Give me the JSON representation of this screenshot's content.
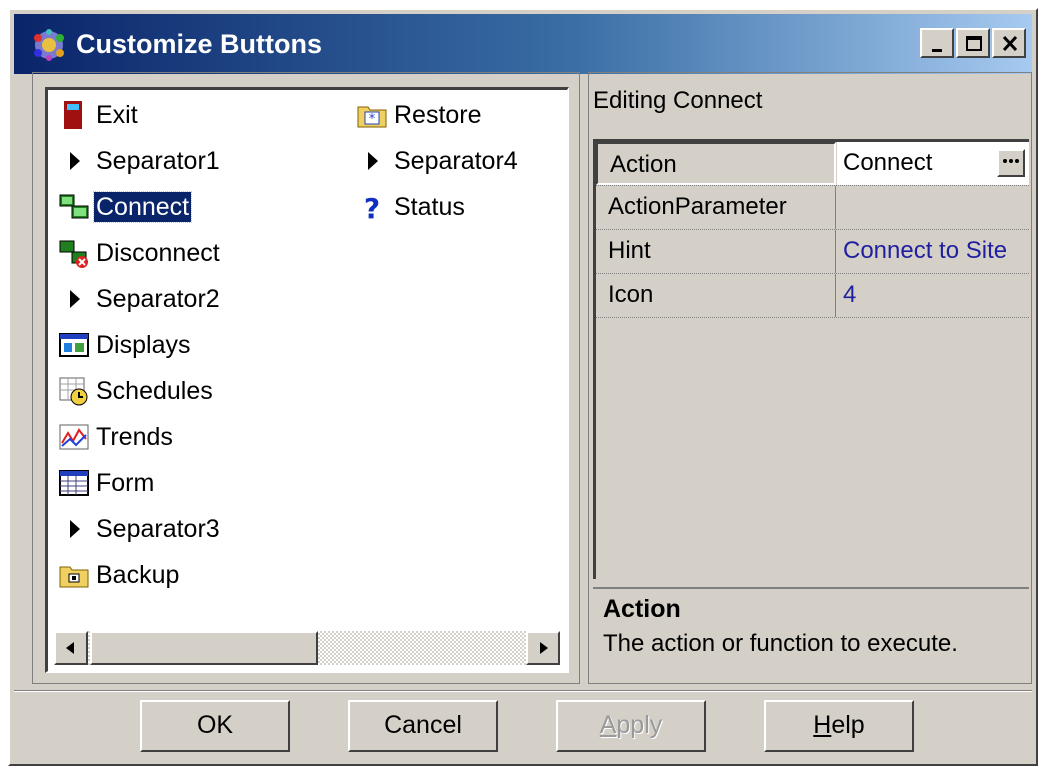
{
  "window": {
    "title": "Customize Buttons"
  },
  "list": {
    "items": [
      {
        "label": "Exit",
        "icon": "exit-door-icon"
      },
      {
        "label": "Separator1",
        "icon": "separator-arrow-icon"
      },
      {
        "label": "Connect",
        "icon": "connect-icon",
        "selected": true
      },
      {
        "label": "Disconnect",
        "icon": "disconnect-icon"
      },
      {
        "label": "Separator2",
        "icon": "separator-arrow-icon"
      },
      {
        "label": "Displays",
        "icon": "displays-icon"
      },
      {
        "label": "Schedules",
        "icon": "schedules-icon"
      },
      {
        "label": "Trends",
        "icon": "trends-icon"
      },
      {
        "label": "Form",
        "icon": "form-icon"
      },
      {
        "label": "Separator3",
        "icon": "separator-arrow-icon"
      },
      {
        "label": "Backup",
        "icon": "backup-folder-icon"
      },
      {
        "label": "Restore",
        "icon": "restore-folder-icon"
      },
      {
        "label": "Separator4",
        "icon": "separator-arrow-icon"
      },
      {
        "label": "Status",
        "icon": "status-question-icon"
      }
    ]
  },
  "inspector": {
    "heading": "Editing Connect",
    "properties": [
      {
        "name": "Action",
        "value": "Connect"
      },
      {
        "name": "ActionParameter",
        "value": ""
      },
      {
        "name": "Hint",
        "value": "Connect to Site"
      },
      {
        "name": "Icon",
        "value": "4"
      }
    ],
    "description_title": "Action",
    "description_text": "The action or function to execute."
  },
  "buttons": {
    "ok": "OK",
    "cancel": "Cancel",
    "apply_pre": "",
    "apply_key": "A",
    "apply_post": "pply",
    "help_key": "H",
    "help_post": "elp"
  },
  "colors": {
    "title_start": "#0a246a",
    "title_end": "#a6caf0",
    "selection": "#0a246a",
    "face": "#d4d0c8"
  }
}
